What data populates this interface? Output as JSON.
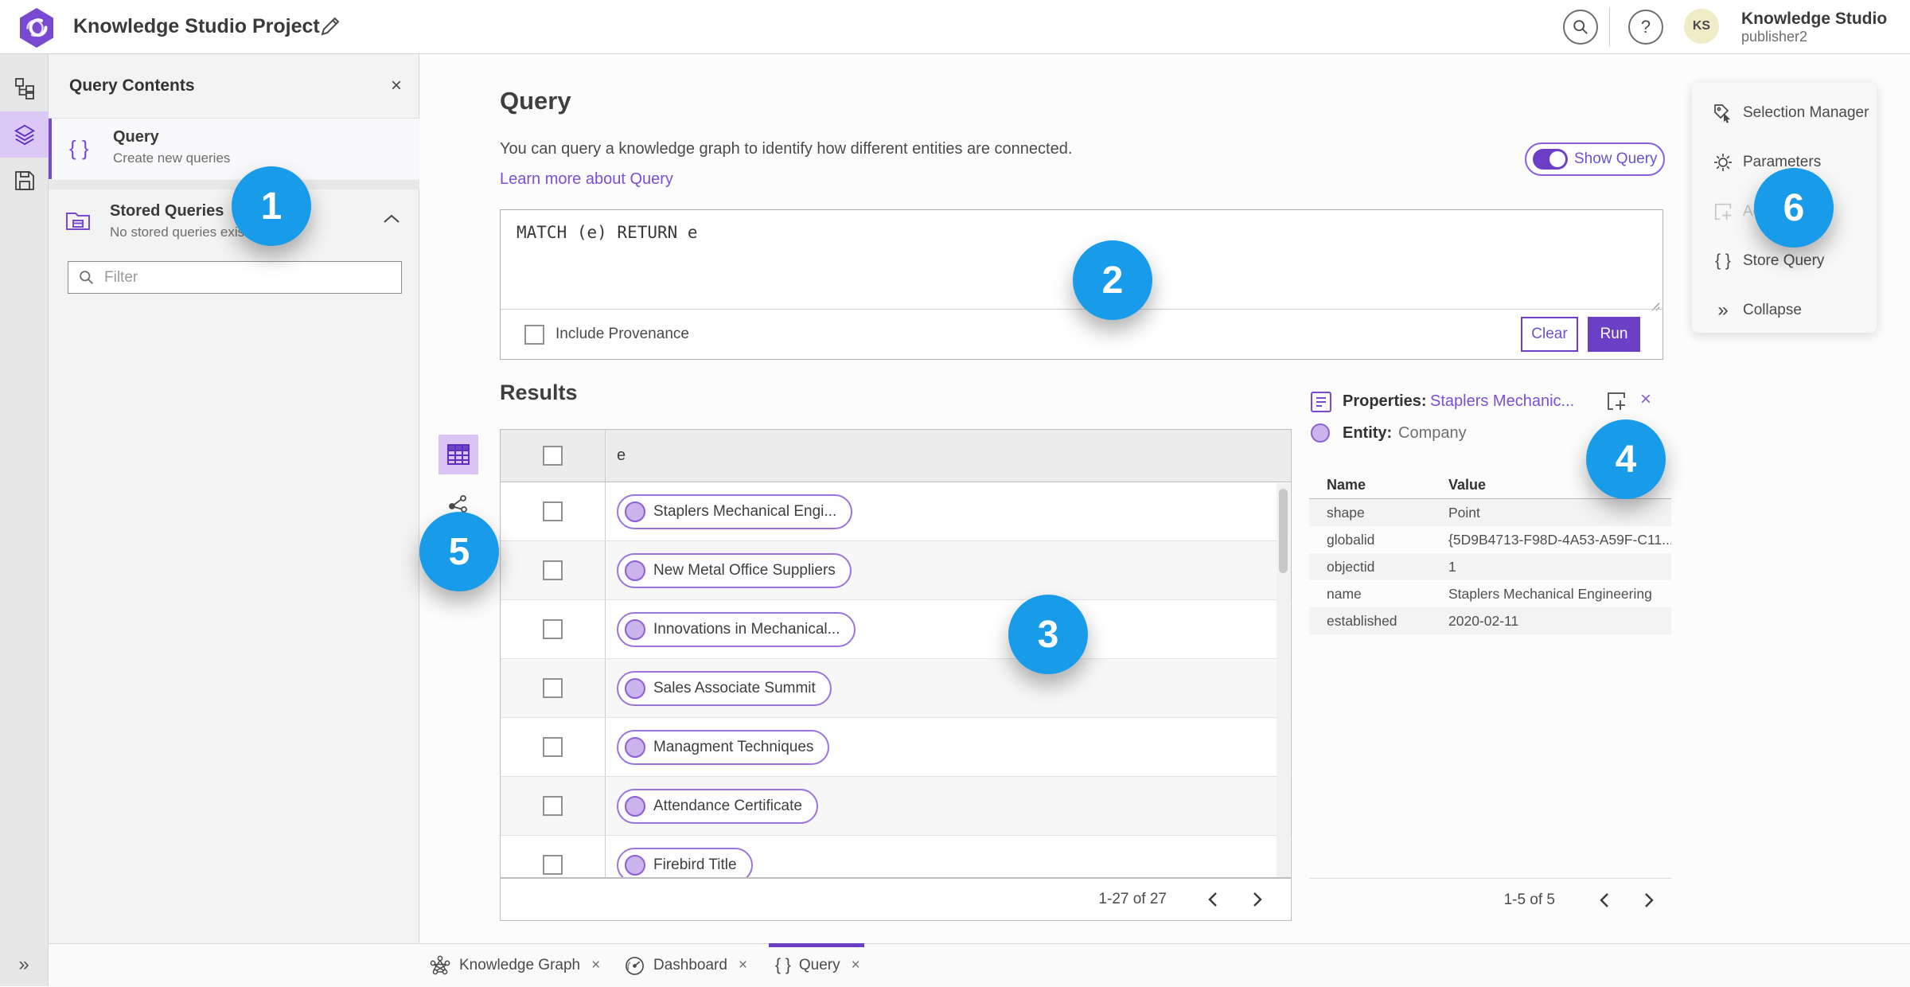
{
  "topbar": {
    "title": "Knowledge Studio Project",
    "user_name": "Knowledge Studio",
    "user_role": "publisher2",
    "avatar_initials": "KS",
    "help_glyph": "?"
  },
  "contents_panel": {
    "title": "Query Contents",
    "close_glyph": "×",
    "items": [
      {
        "title": "Query",
        "subtitle": "Create new queries"
      },
      {
        "title": "Stored Queries",
        "subtitle": "No stored queries exist"
      }
    ],
    "filter_placeholder": "Filter"
  },
  "query": {
    "heading": "Query",
    "description": "You can query a knowledge graph to identify how different entities are connected.",
    "learn_more": "Learn more about Query",
    "show_query_label": "Show Query",
    "query_text": "MATCH (e) RETURN e",
    "include_provenance_label": "Include Provenance",
    "clear_label": "Clear",
    "run_label": "Run"
  },
  "results": {
    "heading": "Results",
    "column_header": "e",
    "rows": [
      "Staplers Mechanical Engi...",
      "New Metal Office Suppliers",
      "Innovations in Mechanical...",
      "Sales Associate Summit",
      "Managment Techniques",
      "Attendance Certificate",
      "Firebird Title"
    ],
    "pagination": "1-27 of 27"
  },
  "properties": {
    "label": "Properties:",
    "entity_name": "Staplers Mechanic...",
    "entity_label": "Entity:",
    "entity_type": "Company",
    "close_glyph": "×",
    "columns": {
      "name": "Name",
      "value": "Value"
    },
    "rows": [
      {
        "name": "shape",
        "value": "Point"
      },
      {
        "name": "globalid",
        "value": "{5D9B4713-F98D-4A53-A59F-C11..."
      },
      {
        "name": "objectid",
        "value": "1"
      },
      {
        "name": "name",
        "value": "Staplers Mechanical Engineering"
      },
      {
        "name": "established",
        "value": "2020-02-11"
      }
    ],
    "pagination": "1-5 of 5"
  },
  "side_menu": {
    "items": [
      {
        "label": "Selection Manager"
      },
      {
        "label": "Parameters"
      },
      {
        "label": "Ad"
      },
      {
        "label": "Store Query"
      },
      {
        "label": "Collapse"
      }
    ],
    "braces_glyph": "{ }",
    "collapse_glyph": "»"
  },
  "tabs": [
    {
      "label": "Knowledge Graph",
      "close_glyph": "×"
    },
    {
      "label": "Dashboard",
      "close_glyph": "×"
    },
    {
      "label": "Query",
      "close_glyph": "×"
    }
  ],
  "tab_braces_glyph": "{ }",
  "panel_braces_glyph": "{ }",
  "annotations": {
    "n1": "1",
    "n2": "2",
    "n3": "3",
    "n4": "4",
    "n5": "5",
    "n6": "6"
  },
  "colors": {
    "accent_purple": "#6b3fc6",
    "light_purple": "#dcc8f7",
    "annotation_blue": "#189be8",
    "avatar_yellow": "#f0ecc8"
  },
  "rail_expand_glyph": "»"
}
